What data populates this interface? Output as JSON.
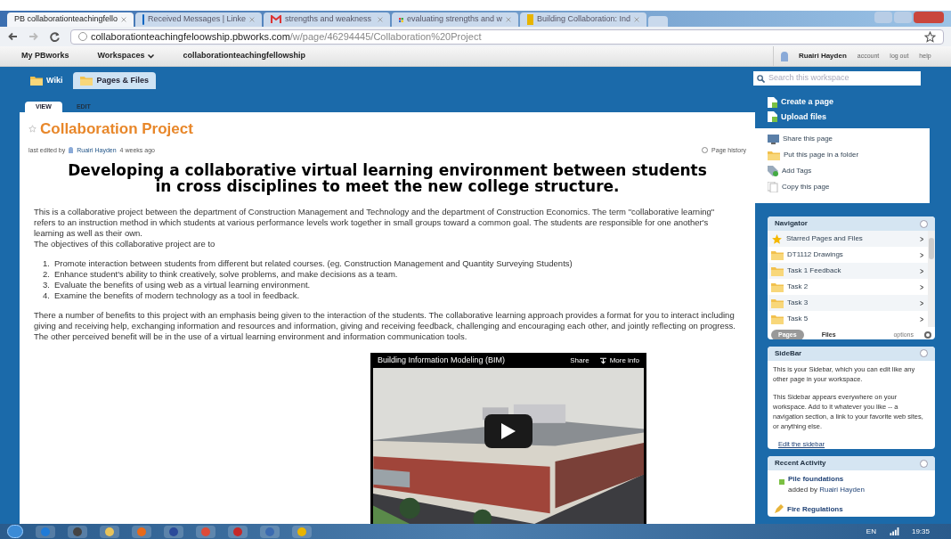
{
  "browser": {
    "tabs": [
      {
        "label": "PB collaborationteachingfello",
        "selected": true
      },
      {
        "label": "Received Messages | Linke",
        "selected": false
      },
      {
        "label": "strengths and weakness",
        "selected": false
      },
      {
        "label": "evaluating strengths and w",
        "selected": false
      },
      {
        "label": "Building Collaboration: Ind",
        "selected": false
      }
    ],
    "url_host": "collaborationteachingfeloowship.pbworks.com",
    "url_path": "/w/page/46294445/Collaboration%20Project"
  },
  "pb_bar": {
    "home": "My PBworks",
    "workspaces": "Workspaces",
    "workspace": "collaborationteachingfellowship",
    "user": "Ruairi Hayden",
    "links": [
      "account",
      "log out",
      "help"
    ]
  },
  "wiki_tabs": [
    {
      "label": "Wiki",
      "selected": false
    },
    {
      "label": "Pages & Files",
      "selected": true
    }
  ],
  "search": {
    "placeholder": "Search this workspace"
  },
  "page": {
    "view_tabs": [
      {
        "label": "VIEW",
        "selected": true
      },
      {
        "label": "EDIT",
        "selected": false
      }
    ],
    "title": "Collaboration Project",
    "edited_prefix": "last edited by",
    "edited_user": "Ruairi Hayden",
    "edited_suffix": "4 weeks ago",
    "history": "Page history",
    "heading": "Developing a collaborative virtual learning environment between students in cross disciplines to meet the new college structure.",
    "intro": "This is a collaborative project between the department of Construction Management and Technology and the department of Construction Economics. The term \"collaborative learning\" refers to an instruction method in which students at various performance levels work together in small groups toward a common goal. The students are responsible for one another's learning as well as their own.",
    "objectives_intro": "The objectives of this collaborative project are to",
    "objectives": [
      {
        "number": "1.",
        "text": "Promote interaction between students from different but related courses. (eg. Construction Management and Quantity Surveying Students)"
      },
      {
        "number": "2.",
        "text": "Enhance student's ability to think creatively, solve problems, and make decisions as a team."
      },
      {
        "number": "3.",
        "text": "Evaluate the benefits of using web as a virtual learning environment."
      },
      {
        "number": "4.",
        "text": "Examine the benefits of modern technology as a tool in feedback."
      }
    ],
    "benefits": "There a number of benefits to this project with an emphasis being given to the interaction of the students. The collaborative learning approach provides a format for you to interact including giving and receiving help, exchanging information and resources and information, giving and receiving feedback, challenging and encouraging each other, and jointly reflecting on progress. The other perceived benefit will be in the use of a virtual learning environment and information communication tools.",
    "video": {
      "title": "Building Information Modeling (BIM)",
      "share": "Share",
      "more_info": "More info",
      "kind": "picture"
    }
  },
  "sidebar": {
    "actions": [
      "Create a page",
      "Upload files"
    ],
    "page_actions": [
      {
        "label": "Share this page",
        "kind": "share"
      },
      {
        "label": "Put this page in a folder",
        "kind": "folder"
      },
      {
        "label": "Add Tags",
        "kind": "tag"
      },
      {
        "label": "Copy this page",
        "kind": "copy"
      }
    ],
    "navigator": {
      "title": "Navigator",
      "items": [
        {
          "label": "Starred Pages and Files",
          "kind": "star"
        },
        {
          "label": "DT1112 Drawings",
          "kind": "folder"
        },
        {
          "label": "Task 1 Feedback",
          "kind": "folder"
        },
        {
          "label": "Task 2",
          "kind": "folder"
        },
        {
          "label": "Task 3",
          "kind": "folder"
        },
        {
          "label": "Task 5",
          "kind": "folder"
        }
      ],
      "tabs": [
        {
          "label": "Pages",
          "selected": true
        },
        {
          "label": "Files",
          "selected": false
        }
      ],
      "options": "options"
    },
    "sidebar_box": {
      "title": "SideBar",
      "paragraphs": [
        "This is your Sidebar, which you can edit like any other page in your workspace.",
        "This Sidebar appears everywhere on your workspace. Add to it whatever you like -- a navigation section, a link to your favorite web sites, or anything else."
      ],
      "link": "Edit the sidebar"
    },
    "recent": {
      "title": "Recent Activity",
      "items": [
        {
          "title": "Pile foundations",
          "by": "added by",
          "user": "Ruairi Hayden",
          "kind": "added"
        },
        {
          "title": "Fire Regulations",
          "kind": "edited"
        }
      ]
    }
  },
  "taskbar": {
    "language": "EN",
    "time": "19:35"
  }
}
